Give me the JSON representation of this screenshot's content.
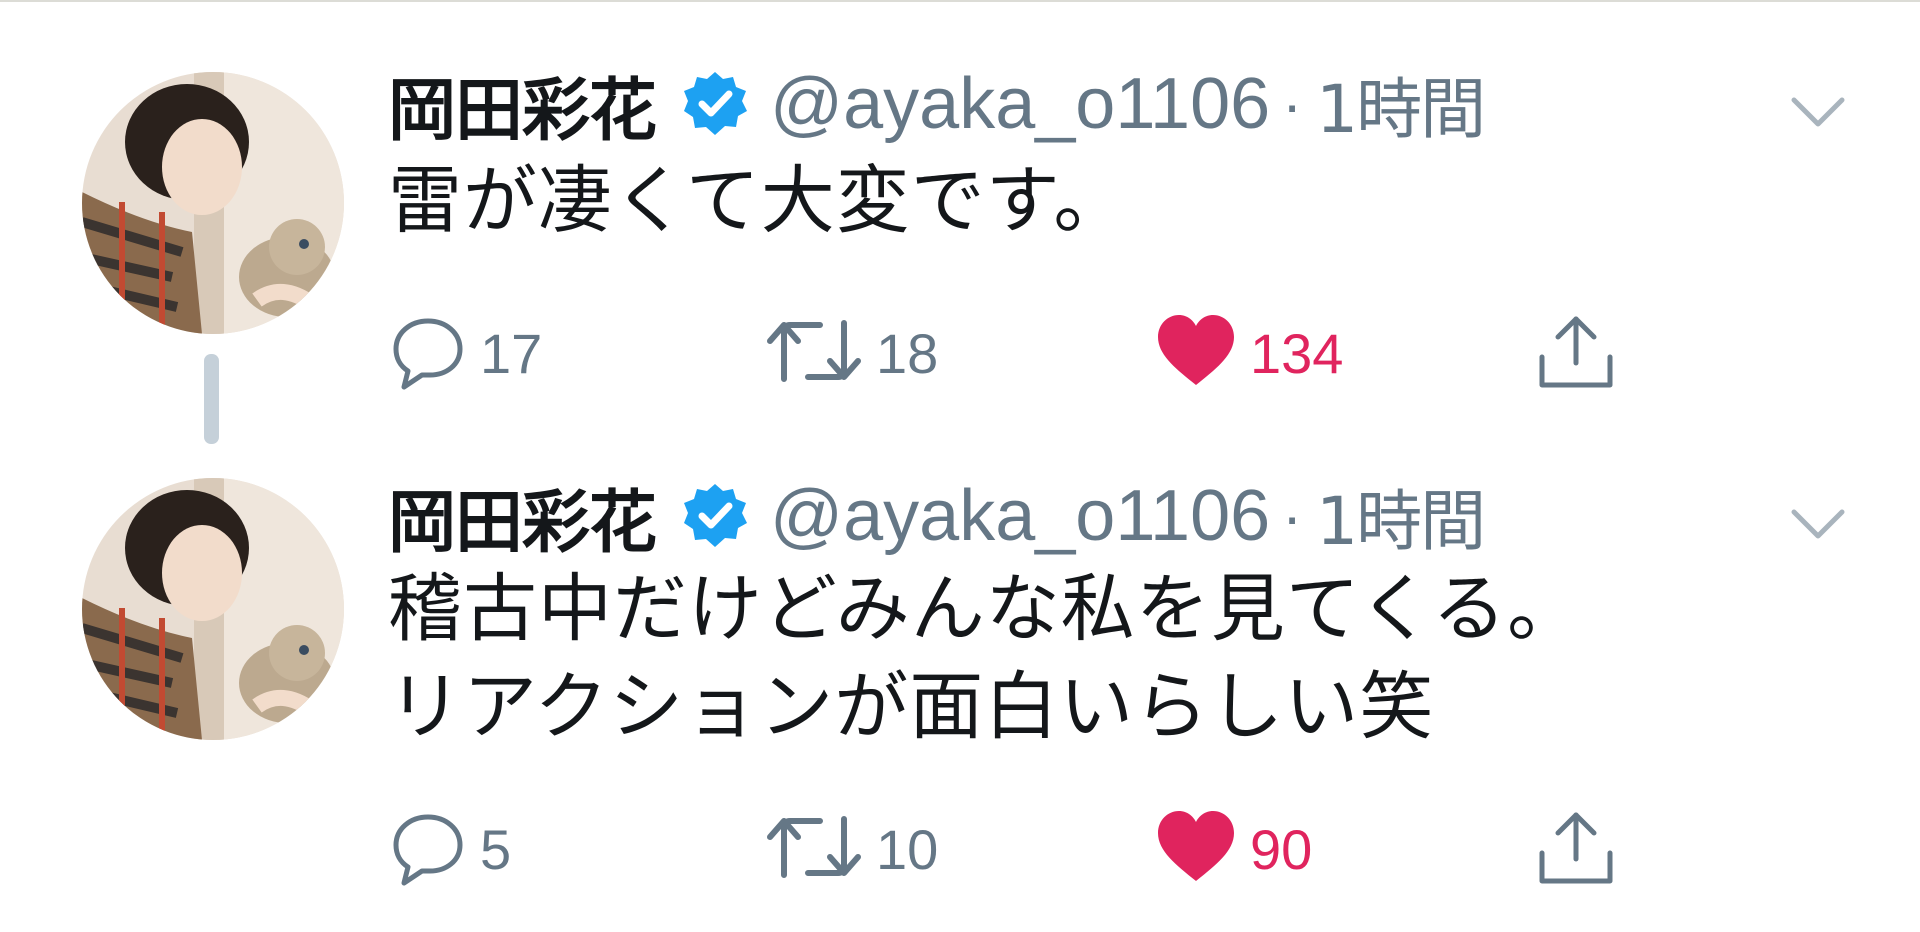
{
  "tweets": [
    {
      "author": {
        "name": "岡田彩花",
        "handle": "@ayaka_o1106",
        "verified": true
      },
      "separator": "·",
      "time": "1時間",
      "text_lines": [
        "雷が凄くて大変です。"
      ],
      "counts": {
        "reply": "17",
        "retweet": "18",
        "like": "134"
      },
      "liked": true
    },
    {
      "author": {
        "name": "岡田彩花",
        "handle": "@ayaka_o1106",
        "verified": true
      },
      "separator": "·",
      "time": "1時間",
      "text_lines": [
        "稽古中だけどみんな私を見てくる。",
        "リアクションが面白いらしい笑"
      ],
      "counts": {
        "reply": "5",
        "retweet": "10",
        "like": "90"
      },
      "liked": true
    }
  ],
  "icons": {
    "verified": "verified-badge-icon",
    "caret": "chevron-down-icon",
    "reply": "reply-bubble-icon",
    "retweet": "retweet-icon",
    "like": "heart-icon",
    "share": "share-upload-icon"
  },
  "colors": {
    "verified_blue": "#1da1f2",
    "like_red": "#e0245e",
    "secondary_text": "#657786",
    "primary_text": "#14171a",
    "thread_line": "#c5d0d9"
  }
}
